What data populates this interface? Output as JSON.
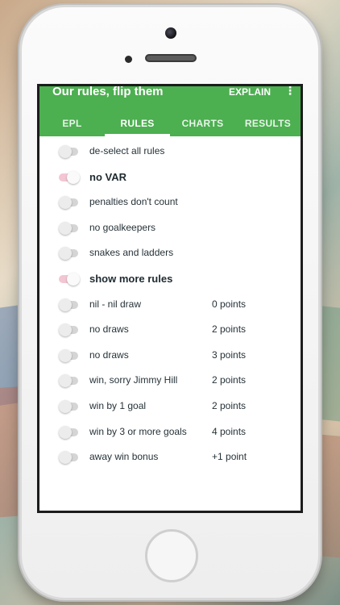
{
  "app": {
    "title": "Our rules, flip them",
    "explain_label": "EXPLAIN",
    "menu_icon": "more-vertical-icon",
    "accent_color": "#4caf50"
  },
  "tabs": [
    {
      "label": "EPL",
      "active": false
    },
    {
      "label": "RULES",
      "active": true
    },
    {
      "label": "CHARTS",
      "active": false
    },
    {
      "label": "RESULTS",
      "active": false
    }
  ],
  "rules": [
    {
      "label": "de-select all rules",
      "enabled": false,
      "bold": false,
      "points": ""
    },
    {
      "label": "no VAR",
      "enabled": true,
      "bold": true,
      "points": ""
    },
    {
      "label": "penalties don't count",
      "enabled": false,
      "bold": false,
      "points": ""
    },
    {
      "label": "no goalkeepers",
      "enabled": false,
      "bold": false,
      "points": ""
    },
    {
      "label": "snakes and ladders",
      "enabled": false,
      "bold": false,
      "points": ""
    },
    {
      "label": "show more rules",
      "enabled": true,
      "bold": true,
      "points": ""
    },
    {
      "label": "nil - nil draw",
      "enabled": false,
      "bold": false,
      "points": "0 points"
    },
    {
      "label": "no draws",
      "enabled": false,
      "bold": false,
      "points": "2 points"
    },
    {
      "label": "no draws",
      "enabled": false,
      "bold": false,
      "points": "3 points"
    },
    {
      "label": "win, sorry Jimmy Hill",
      "enabled": false,
      "bold": false,
      "points": "2 points"
    },
    {
      "label": "win by 1 goal",
      "enabled": false,
      "bold": false,
      "points": "2 points"
    },
    {
      "label": "win by 3 or more goals",
      "enabled": false,
      "bold": false,
      "points": "4 points"
    },
    {
      "label": "away win bonus",
      "enabled": false,
      "bold": false,
      "points": "+1 point"
    }
  ]
}
